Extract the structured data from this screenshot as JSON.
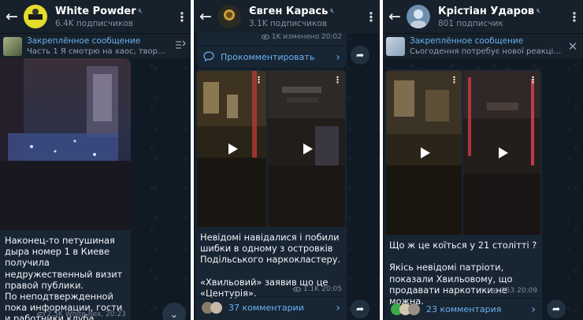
{
  "colors": {
    "header_bg": "#17212b",
    "chat_bg": "#0f1a24",
    "bubble_bg": "#182533",
    "link": "#6ab2f2",
    "meta": "#7c8b9b"
  },
  "panel1": {
    "channel_name": "White Powder",
    "subscribers": "6.4K подписчиков",
    "pinned_title": "Закреплённое сообщение",
    "pinned_text": "Часть 1  Я смотрю на хаос, творящий...",
    "message_text": "Наконец-то петушиная дыра номер 1 в Киеве получила недружественный визит правой публики.\nПо неподтвержденной пока информации, гости и работники клуба Хвылевой в ахуе...",
    "views": "2.5K",
    "author_time": "White Rex, 20:23",
    "icons": {
      "back": "arrow-left-icon",
      "more": "more-vertical-icon",
      "pin_action": "pin-list-icon",
      "scroll": "chevron-down-icon"
    }
  },
  "panel2": {
    "channel_name": "Євген Карась",
    "subscribers": "3.1K подписчиков",
    "top_meta_views": "1K",
    "top_meta_time": "изменено 20:02",
    "comment_action": "Прокомментировать",
    "message_text": "Невідомі навідалися і побили шибки в одному з островків Подільського наркокластеру.\n\n«Хвильовий» заявив що це «Центурія».",
    "views": "1.1K",
    "time": "20:05",
    "comments": "37 комментарии",
    "icons": {
      "back": "arrow-left-icon",
      "more": "more-vertical-icon",
      "share": "share-arrow-icon",
      "comment": "comment-bubble-icon"
    }
  },
  "panel3": {
    "channel_name": "Крістіан Ударов",
    "subscribers": "801 подписчик",
    "pinned_title": "Закреплённое сообщение",
    "pinned_text": "Сьогодення потребує нової реакції на...",
    "message_text": "Що ж це коїться у 21 столітті ?\n\nЯкісь невідомі патріоти, показали Хвильовому, що продавати наркотики не можна.",
    "views": "253",
    "time": "20:09",
    "comments": "23 комментария",
    "icons": {
      "back": "arrow-left-icon",
      "more": "more-vertical-icon",
      "close": "close-icon",
      "share": "share-arrow-icon"
    }
  }
}
